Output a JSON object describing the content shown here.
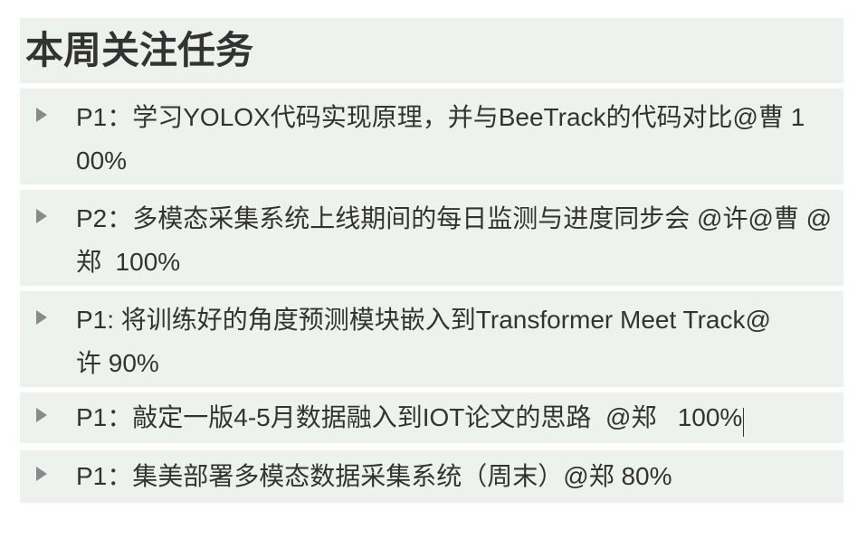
{
  "heading": "本周关注任务",
  "tasks": [
    {
      "text": "P1：学习YOLOX代码实现原理，并与BeeTrack的代码对比@曹 100%",
      "icon": "triangle-right-icon"
    },
    {
      "text": "P2：多模态采集系统上线期间的每日监测与进度同步会 @许@曹 @郑  100%",
      "icon": "triangle-right-icon"
    },
    {
      "text": "P1: 将训练好的角度预测模块嵌入到Transformer Meet Track@许 90%",
      "icon": "triangle-right-icon"
    },
    {
      "text": "P1：敲定一版4-5月数据融入到IOT论文的思路  @郑   100%",
      "icon": "triangle-right-icon"
    },
    {
      "text": "P1：集美部署多模态数据采集系统（周末）@郑 80%",
      "icon": "triangle-right-icon"
    }
  ],
  "colors": {
    "block_bg": "#eef2ee",
    "text": "#333333",
    "toggle": "#8a8a8a"
  }
}
